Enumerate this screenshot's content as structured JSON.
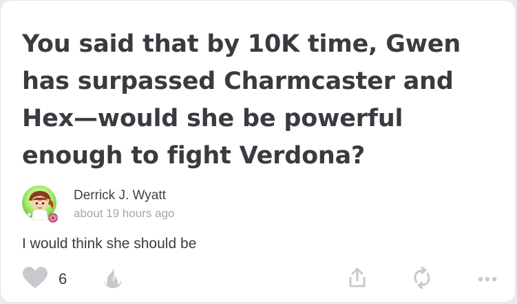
{
  "question": {
    "text": "You said that by 10K time, Gwen has surpassed Charmcaster and Hex—would she be powerful enough to fight Verdona?"
  },
  "answer": {
    "author": "Derrick J. Wyatt",
    "timestamp": "about 19 hours ago",
    "text": "I would think she should be"
  },
  "actions": {
    "like_count": "6",
    "icons": [
      "heart-icon",
      "fire-icon",
      "share-icon",
      "repost-icon",
      "more-icon"
    ]
  },
  "colors": {
    "text": "#3a3a40",
    "muted": "#a6a6ae",
    "icon": "#c8c8cf",
    "background": "#ffffff"
  }
}
